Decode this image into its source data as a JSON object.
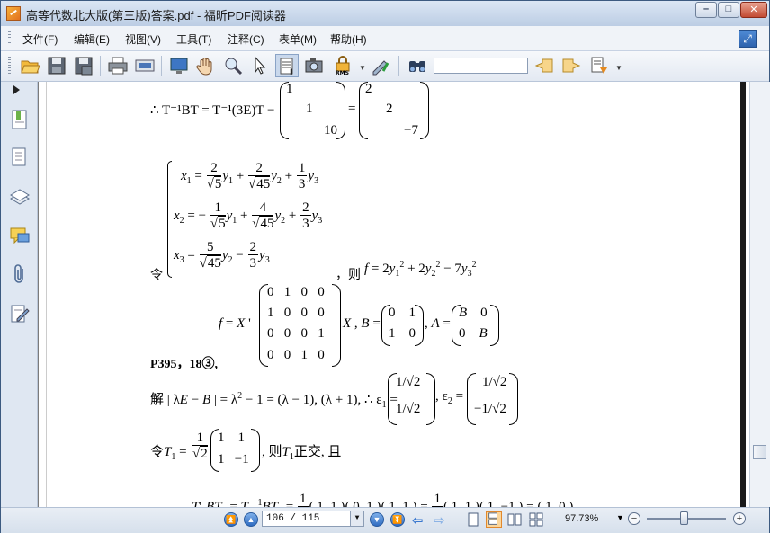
{
  "window": {
    "title": "高等代数北大版(第三版)答案.pdf - 福昕PDF阅读器",
    "minimize": "–",
    "maximize": "□",
    "close": "✕"
  },
  "menu": [
    "文件(F)",
    "编辑(E)",
    "视图(V)",
    "工具(T)",
    "注释(C)",
    "表单(M)",
    "帮助(H)"
  ],
  "toolbar": {
    "icons": [
      "open-icon",
      "save-icon",
      "save-as-icon",
      "print-icon",
      "scan-icon",
      "fullscreen-icon",
      "hand-tool-icon",
      "zoom-tool-icon",
      "select-arrow-icon",
      "text-select-icon",
      "snapshot-icon",
      "rms-icon",
      "sign-icon",
      "find-icon",
      "prev-result-icon",
      "next-result-icon",
      "highlight-icon"
    ],
    "search_value": ""
  },
  "statusbar": {
    "page_field": "106 / 115",
    "zoom": "97.73%"
  },
  "document": {
    "line1": "∴ T⁻¹BT = T⁻¹(3E)T −",
    "matrixA": [
      "1",
      "1",
      "10"
    ],
    "matrixB": [
      "2",
      "2",
      "−7"
    ],
    "sys_prefix": "令",
    "sys_then": "，则",
    "heading": "P395，18③,",
    "sol_prefix": "解",
    "then_ortho": ",则T₁正交, 且",
    "let_t1": "令T₁ ="
  }
}
